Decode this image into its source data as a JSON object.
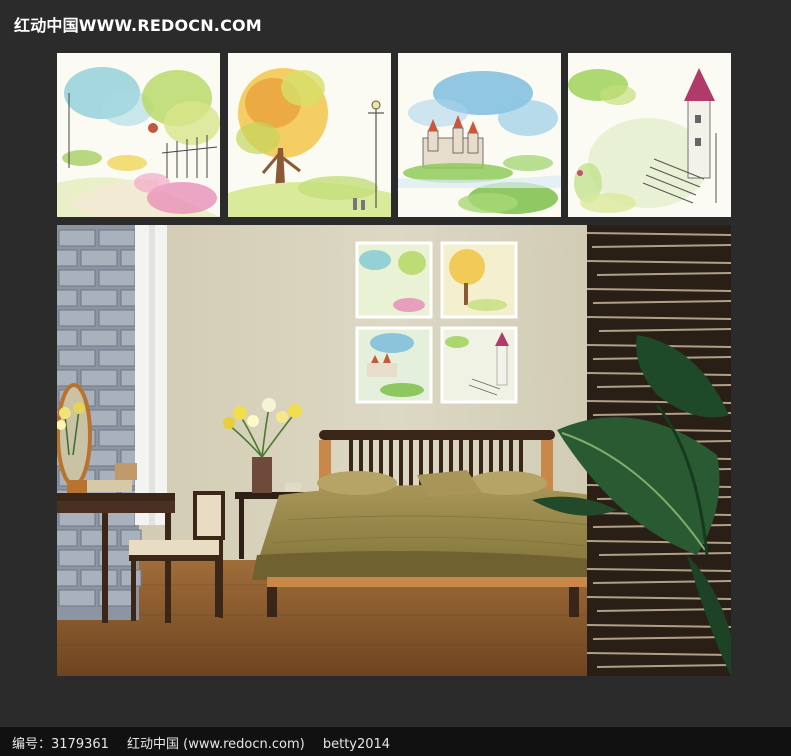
{
  "header": {
    "site_title": "红动中国WWW.REDOCN.COM"
  },
  "thumbnails": [
    {
      "subject": "watercolor garden path with fence and flowers"
    },
    {
      "subject": "watercolor autumn tree with lamp post"
    },
    {
      "subject": "watercolor castle with clouds and bushes"
    },
    {
      "subject": "watercolor tower with stairs and plants"
    }
  ],
  "room_scene": {
    "subject": "bedroom interior with four framed paintings above a wooden bed"
  },
  "footer": {
    "id_label": "编号：3179361",
    "site_label": "红动中国 (www.redocn.com)",
    "author": "betty2014"
  },
  "colors": {
    "background": "#2b2b2b",
    "footer": "#111111",
    "wall": "#d8d3bd",
    "floor": "#8a5a2b",
    "bedspread": "#9b8a4c"
  }
}
